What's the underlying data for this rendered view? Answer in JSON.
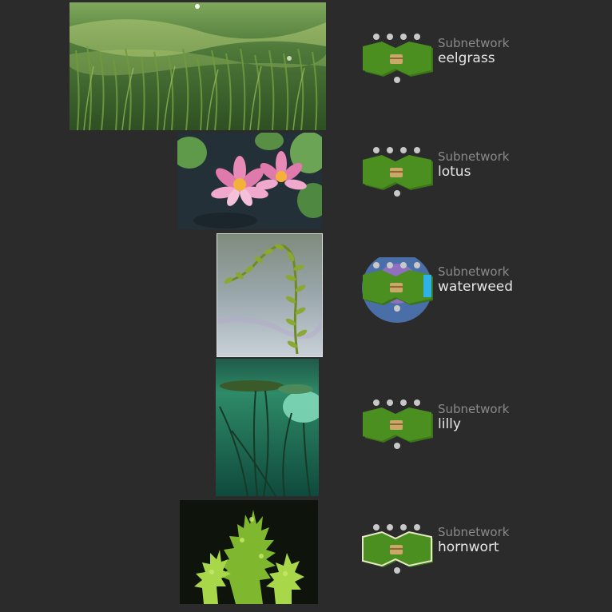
{
  "nodes": [
    {
      "type": "Subnetwork",
      "name": "eelgrass",
      "thumb": "eelgrass underwater seagrass photo",
      "icon": "subnetwork-green-icon"
    },
    {
      "type": "Subnetwork",
      "name": "lotus",
      "thumb": "pink water lily flower photo",
      "icon": "subnetwork-green-icon"
    },
    {
      "type": "Subnetwork",
      "name": "waterweed",
      "thumb": "waterweed stem photo",
      "icon": "subnetwork-selected-icon"
    },
    {
      "type": "Subnetwork",
      "name": "lilly",
      "thumb": "lily pads from underwater photo",
      "icon": "subnetwork-green-icon"
    },
    {
      "type": "Subnetwork",
      "name": "hornwort",
      "thumb": "hornwort plant photo",
      "icon": "subnetwork-outlined-icon"
    }
  ],
  "colors": {
    "background": "#2b2b2b",
    "node_green": "#4a8f1f",
    "node_green_dark": "#3a7418",
    "selection_blue": "#4a6fa8",
    "selection_purple": "#8e6fc0",
    "selection_cyan": "#2fb2e8",
    "connector_dot": "#c8c8c8",
    "box_tan": "#c9a86a"
  }
}
